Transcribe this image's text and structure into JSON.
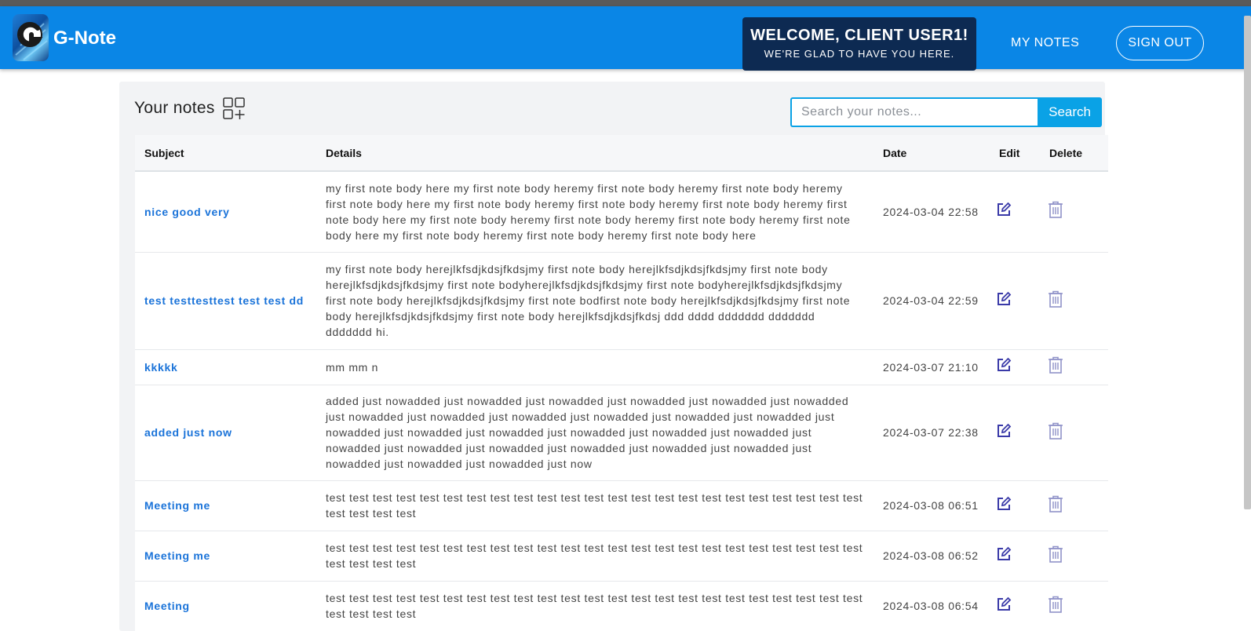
{
  "header": {
    "brand": "G-Note",
    "welcome_title": "WELCOME, CLIENT USER1!",
    "welcome_subtitle": "WE'RE GLAD TO HAVE YOU HERE.",
    "nav_my_notes": "MY NOTES",
    "sign_out": "SIGN OUT"
  },
  "notes_panel": {
    "title": "Your notes",
    "search_placeholder": "Search your notes...",
    "search_button": "Search"
  },
  "table": {
    "columns": [
      "Subject",
      "Details",
      "Date",
      "Edit",
      "Delete"
    ],
    "rows": [
      {
        "subject": "nice good very",
        "details": "my first note body here my first note body heremy first note body heremy first note body heremy first note body here my first note body heremy first note body heremy first note body heremy first note body here my first note body heremy first note body heremy first note body heremy first note body here my first note body heremy first note body heremy first note body here",
        "date": "2024-03-04 22:58"
      },
      {
        "subject": "test testtesttest test test dd",
        "details": "my first note body herejlkfsdjkdsjfkdsjmy first note body herejlkfsdjkdsjfkdsjmy first note body herejlkfsdjkdsjfkdsjmy first note bodyherejlkfsdjkdsjfkdsjmy first note bodyherejlkfsdjkdsjfkdsjmy first note body herejlkfsdjkdsjfkdsjmy first note bodfirst note body herejlkfsdjkdsjfkdsjmy first note body herejlkfsdjkdsjfkdsjmy first note body herejlkfsdjkdsjfkdsj ddd dddd ddddddd ddddddd ddddddd hi.",
        "date": "2024-03-04 22:59"
      },
      {
        "subject": "kkkkk",
        "details": "mm mm n",
        "date": "2024-03-07 21:10"
      },
      {
        "subject": "added just now",
        "details": "added just nowadded just nowadded just nowadded just nowadded just nowadded just nowadded just nowadded just nowadded just nowadded just nowadded just nowadded just nowadded just nowadded just nowadded just nowadded just nowadded just nowadded just nowadded just nowadded just nowadded just nowadded just nowadded just nowadded just nowadded just nowadded just nowadded just nowadded just now",
        "date": "2024-03-07 22:38"
      },
      {
        "subject": "Meeting me",
        "details": "test test test test test test test test test test test test test test test test test test test test test test test test test test test",
        "date": "2024-03-08 06:51"
      },
      {
        "subject": "Meeting me",
        "details": "test test test test test test test test test test test test test test test test test test test test test test test test test test test",
        "date": "2024-03-08 06:52"
      },
      {
        "subject": "Meeting",
        "details": "test test test test test test test test test test test test test test test test test test test test test test test test test test test",
        "date": "2024-03-08 06:54"
      }
    ]
  },
  "colors": {
    "navbar": "#0a86e6",
    "welcome_bg": "#0d2a52",
    "accent": "#0aa2e6",
    "subject_link": "#1a73d9",
    "edit_icon": "#3a3aa8",
    "delete_icon": "#8f92c8"
  }
}
